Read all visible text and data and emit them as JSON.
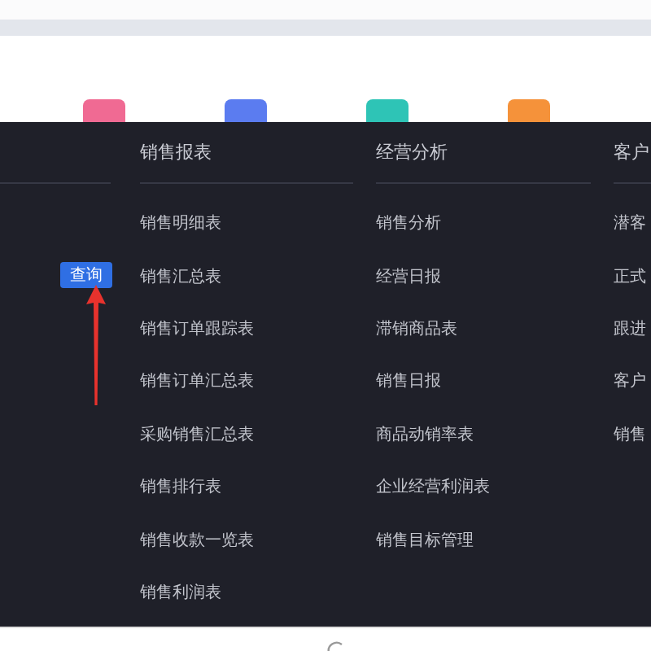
{
  "app_icons": [
    {
      "color": "#f06a93"
    },
    {
      "color": "#5b7cf0"
    },
    {
      "color": "#2ec4b6"
    },
    {
      "color": "#f5923a"
    }
  ],
  "query_button": {
    "label": "查询"
  },
  "menu_columns": [
    {
      "title": "销售报表",
      "items": [
        "销售明细表",
        "销售汇总表",
        "销售订单跟踪表",
        "销售订单汇总表",
        "采购销售汇总表",
        "销售排行表",
        "销售收款一览表",
        "销售利润表"
      ]
    },
    {
      "title": "经营分析",
      "items": [
        "销售分析",
        "经营日报",
        "滞销商品表",
        "销售日报",
        "商品动销率表",
        "企业经营利润表",
        "销售目标管理"
      ]
    },
    {
      "title": "客户",
      "items": [
        "潜客",
        "正式",
        "跟进",
        "客户",
        "销售"
      ]
    }
  ]
}
